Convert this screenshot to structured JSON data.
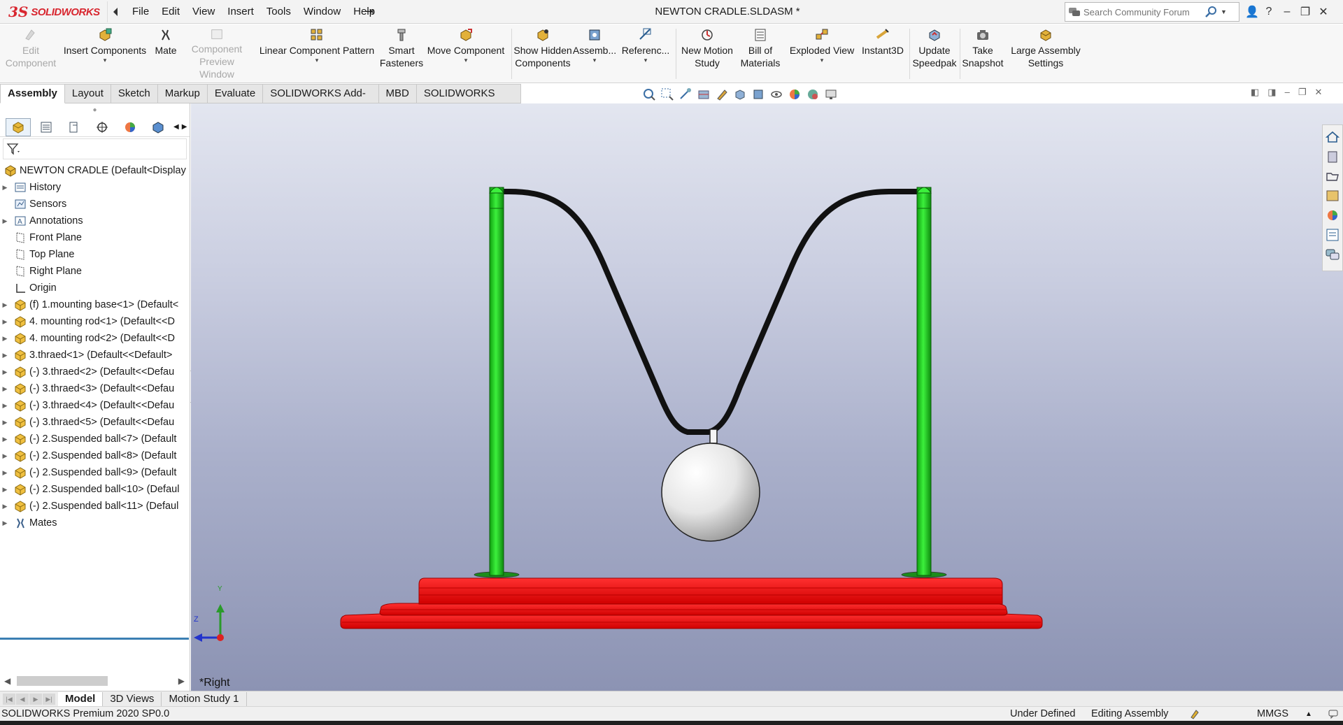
{
  "app": {
    "logo_mark": "3S",
    "logo_text": "SOLIDWORKS",
    "document_title": "NEWTON CRADLE.SLDASM *",
    "pin_glyph": "⇥"
  },
  "menu": [
    "File",
    "Edit",
    "View",
    "Insert",
    "Tools",
    "Window",
    "Help"
  ],
  "search": {
    "placeholder": "Search Community Forum"
  },
  "window_controls": [
    "👤",
    "?",
    "–",
    "❐",
    "✕"
  ],
  "ribbon": [
    {
      "label": "Edit Component",
      "icon": "edit-component-icon",
      "disabled": true,
      "dropdown": false
    },
    {
      "label": "Insert Components",
      "icon": "insert-components-icon",
      "disabled": false,
      "dropdown": true
    },
    {
      "label": "Mate",
      "icon": "mate-icon",
      "disabled": false,
      "dropdown": false
    },
    {
      "label": "Component Preview Window",
      "icon": "component-preview-icon",
      "disabled": true,
      "dropdown": false
    },
    {
      "label": "Linear Component Pattern",
      "icon": "linear-pattern-icon",
      "disabled": false,
      "dropdown": true
    },
    {
      "label": "Smart Fasteners",
      "icon": "smart-fasteners-icon",
      "disabled": false,
      "dropdown": false
    },
    {
      "label": "Move Component",
      "icon": "move-component-icon",
      "disabled": false,
      "dropdown": true
    },
    {
      "label": "Show Hidden Components",
      "icon": "show-hidden-icon",
      "disabled": false,
      "dropdown": false
    },
    {
      "label": "Assemb...",
      "icon": "assembly-features-icon",
      "disabled": false,
      "dropdown": true
    },
    {
      "label": "Referenc...",
      "icon": "reference-geometry-icon",
      "disabled": false,
      "dropdown": true
    },
    {
      "label": "New Motion Study",
      "icon": "motion-study-icon",
      "disabled": false,
      "dropdown": false
    },
    {
      "label": "Bill of Materials",
      "icon": "bill-of-materials-icon",
      "disabled": false,
      "dropdown": false
    },
    {
      "label": "Exploded View",
      "icon": "exploded-view-icon",
      "disabled": false,
      "dropdown": true
    },
    {
      "label": "Instant3D",
      "icon": "instant3d-icon",
      "disabled": false,
      "dropdown": false
    },
    {
      "label": "Update Speedpak",
      "icon": "speedpak-icon",
      "disabled": false,
      "dropdown": false
    },
    {
      "label": "Take Snapshot",
      "icon": "snapshot-icon",
      "disabled": false,
      "dropdown": false
    },
    {
      "label": "Large Assembly Settings",
      "icon": "large-assembly-icon",
      "disabled": false,
      "dropdown": false
    }
  ],
  "tabs": [
    "Assembly",
    "Layout",
    "Sketch",
    "Markup",
    "Evaluate",
    "SOLIDWORKS Add-Ins",
    "MBD",
    "SOLIDWORKS CAM"
  ],
  "active_tab": "Assembly",
  "tree": {
    "root": "NEWTON CRADLE  (Default<Display",
    "items": [
      {
        "label": "History",
        "icon": "history-icon",
        "expandable": true
      },
      {
        "label": "Sensors",
        "icon": "sensors-icon",
        "expandable": false
      },
      {
        "label": "Annotations",
        "icon": "annotations-icon",
        "expandable": true
      },
      {
        "label": "Front Plane",
        "icon": "plane-icon",
        "expandable": false
      },
      {
        "label": "Top Plane",
        "icon": "plane-icon",
        "expandable": false
      },
      {
        "label": "Right Plane",
        "icon": "plane-icon",
        "expandable": false
      },
      {
        "label": "Origin",
        "icon": "origin-icon",
        "expandable": false
      },
      {
        "label": "(f) 1.mounting base<1> (Default<",
        "icon": "part-icon",
        "expandable": true
      },
      {
        "label": "4. mounting rod<1> (Default<<D",
        "icon": "part-icon",
        "expandable": true
      },
      {
        "label": "4. mounting rod<2> (Default<<D",
        "icon": "part-icon",
        "expandable": true
      },
      {
        "label": "3.thraed<1> (Default<<Default>",
        "icon": "part-icon",
        "expandable": true
      },
      {
        "label": "(-) 3.thraed<2> (Default<<Defau",
        "icon": "part-icon",
        "expandable": true
      },
      {
        "label": "(-) 3.thraed<3> (Default<<Defau",
        "icon": "part-icon",
        "expandable": true
      },
      {
        "label": "(-) 3.thraed<4> (Default<<Defau",
        "icon": "part-icon",
        "expandable": true
      },
      {
        "label": "(-) 3.thraed<5> (Default<<Defau",
        "icon": "part-icon",
        "expandable": true
      },
      {
        "label": "(-) 2.Suspended ball<7> (Default",
        "icon": "part-icon",
        "expandable": true
      },
      {
        "label": "(-) 2.Suspended ball<8> (Default",
        "icon": "part-icon",
        "expandable": true
      },
      {
        "label": "(-) 2.Suspended ball<9> (Default",
        "icon": "part-icon",
        "expandable": true
      },
      {
        "label": "(-) 2.Suspended ball<10> (Defaul",
        "icon": "part-icon",
        "expandable": true
      },
      {
        "label": "(-) 2.Suspended ball<11> (Defaul",
        "icon": "part-icon",
        "expandable": true
      },
      {
        "label": "Mates",
        "icon": "mates-icon",
        "expandable": true
      }
    ]
  },
  "viewport": {
    "view_name": "*Right",
    "triad_axes": [
      "Y",
      "Z"
    ],
    "colors": {
      "base": "#ff1a1a",
      "rods": "#22dd22",
      "thread": "#111111",
      "ball": "#f2f2f2"
    }
  },
  "bottom_tabs": [
    "Model",
    "3D Views",
    "Motion Study 1"
  ],
  "active_bottom_tab": "Model",
  "status": {
    "product": "SOLIDWORKS Premium 2020 SP0.0",
    "definition": "Under Defined",
    "mode": "Editing Assembly",
    "units": "MMGS",
    "units_arrow": "▲"
  }
}
